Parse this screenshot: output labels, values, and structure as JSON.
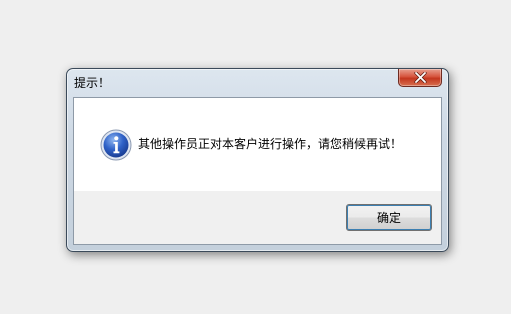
{
  "dialog": {
    "title": "提示！",
    "message": "其他操作员正对本客户进行操作，请您稍候再试！",
    "icon": "info-icon",
    "ok_label": "确定",
    "close_icon": "close-icon"
  }
}
